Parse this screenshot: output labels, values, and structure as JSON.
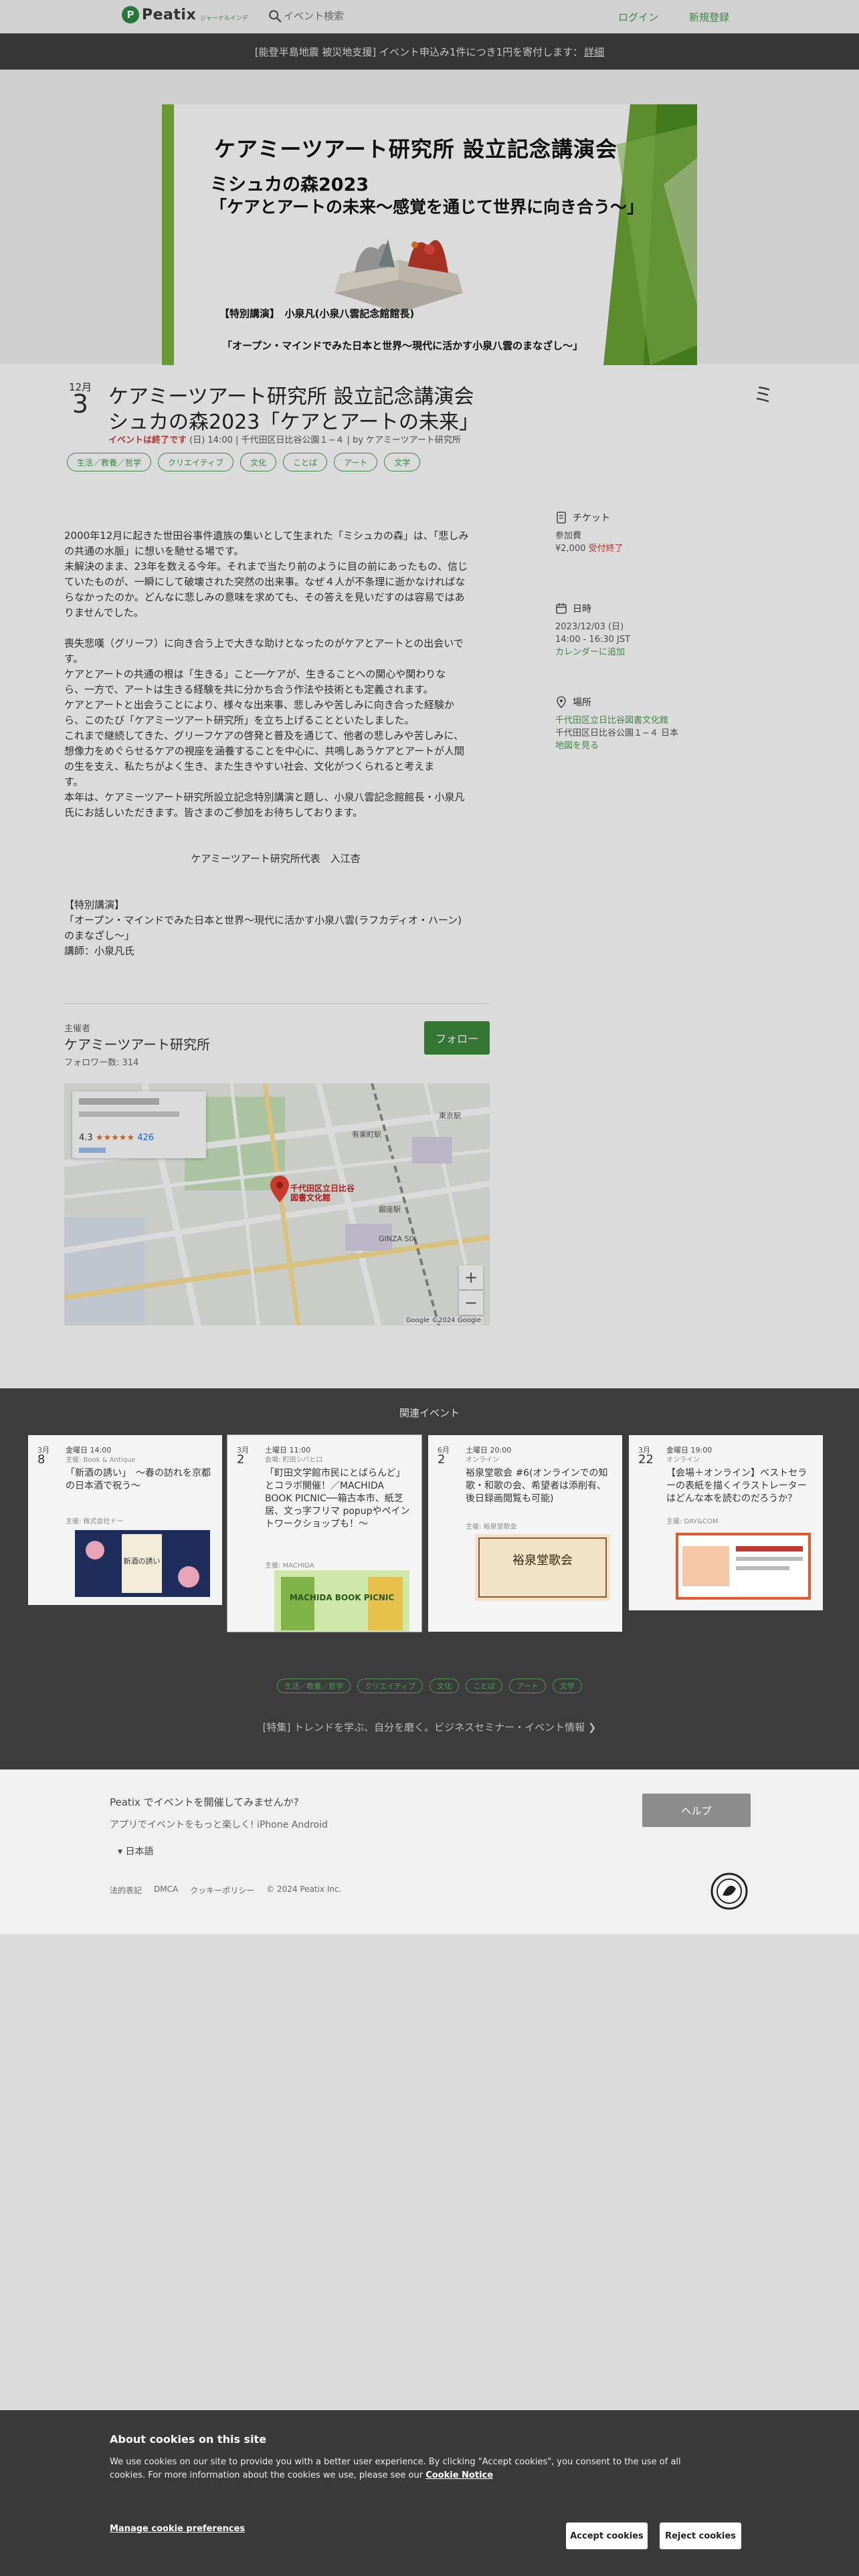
{
  "header": {
    "logo_mark": "P",
    "logo_text": "Peatix",
    "logo_sub": "ジャーナルインデ",
    "search_placeholder": "イベント検索",
    "login": "ログイン",
    "signup": "新規登録"
  },
  "notice": {
    "text": "[能登半島地震 被災地支援] イベント申込み1件につき1円を寄付します：",
    "link": "詳細"
  },
  "hero": {
    "title": "ケアミーツアート研究所 設立記念講演会",
    "sub1": "ミシュカの森2023",
    "sub2": "「ケアとアートの未来〜感覚を通じて世界に向き合う〜」",
    "lecture": "【特別講演】　小泉凡(小泉八雲記念館館長)",
    "lecture2": "「オープン・マインドでみた日本と世界〜現代に活かす小泉八雲のまなざし〜」"
  },
  "event": {
    "month": "12月",
    "day": "3",
    "title1": "ケアミーツアート研究所 設立記念講演会",
    "title2": "シュカの森2023「ケアとアートの未来」",
    "ended": "イベントは終了です",
    "meta": " (日) 14:00 | 千代田区日比谷公園１−４ | by ケアミーツアート研究所",
    "share": "ミ",
    "tags": [
      "生活／教養／哲学",
      "クリエイティブ",
      "文化",
      "ことば",
      "アート",
      "文学"
    ]
  },
  "description": {
    "para1": [
      "2000年12月に起きた世田谷事件遺族の集いとして生まれた「ミシュカの森」は、「悲しみ",
      "の共通の水脈」に想いを馳せる場です。",
      "未解決のまま、23年を数える今年。それまで当たり前のように目の前にあったもの、信じ",
      "ていたものが、一瞬にして破壊された突然の出来事。なぜ４人が不条理に逝かなければな",
      "らなかったのか。どんなに悲しみの意味を求めても、その答えを見いだすのは容易ではあ",
      "りませんでした。"
    ],
    "para2": [
      "喪失悲嘆（グリーフ）に向き合う上で大きな助けとなったのがケアとアートとの出会いで",
      "す。",
      "ケアとアートの共通の根は「生きる」こと──ケアが、生きることへの関心や関わりな",
      "ら、一方で、アートは生きる経験を共に分かち合う作法や技術とも定義されます。",
      "ケアとアートと出会うことにより、様々な出来事、悲しみや苦しみに向き合った経験か",
      "ら、このたび「ケアミーツアート研究所」を立ち上げることといたしました。",
      "これまで継続してきた、グリーフケアの啓発と普及を通じて、他者の悲しみや苦しみに、",
      "想像力をめぐらせるケアの視座を涵養することを中心に、共鳴しあうケアとアートが人間",
      "の生を支え、私たちがよく生き、また生きやすい社会、文化がつくられると考えま",
      "す。",
      "本年は、ケアミーツアート研究所設立記念特別講演と題し、小泉八雲記念館館長・小泉凡",
      "氏にお話しいただきます。皆さまのご参加をお待ちしております。"
    ],
    "signature": "ケアミーツアート研究所代表　入江杏",
    "para3": [
      "【特別講演】",
      "「オープン・マインドでみた日本と世界〜現代に活かす小泉八雲(ラフカディオ・ハーン)",
      "のまなざし〜」",
      "講師：小泉凡氏"
    ]
  },
  "sidebar": {
    "ticket_head": "チケット",
    "ticket_name": "参加費",
    "ticket_price": "¥2,000",
    "ticket_status": "受付終了",
    "date_head": "日時",
    "date_line1": "2023/12/03 (日)",
    "date_line2": "14:00 - 16:30 JST",
    "calendar": "カレンダーに追加",
    "place_head": "場所",
    "place_link": "千代田区立日比谷図書文化館",
    "place_addr": "千代田区日比谷公園１−４ 日本",
    "map_link": "地図を見る"
  },
  "organizer": {
    "label": "主催者",
    "name": "ケアミーツアート研究所",
    "followers": "フォロワー数: 314",
    "follow": "フォロー"
  },
  "map": {
    "rating": "4.3",
    "stars": "★★★★★",
    "count": "426",
    "pin_label1": "千代田区立日比谷",
    "pin_label2": "図書文化館",
    "label_a": "有楽町駅",
    "label_b": "銀座駅",
    "label_c": "GINZA SIX",
    "label_d": "東京駅",
    "zoom_in": "+",
    "zoom_out": "−",
    "copyright": "Google  ©2024 Google"
  },
  "related": {
    "title": "関連イベント",
    "cards": [
      {
        "month": "3月",
        "day": "8",
        "time": "金曜日 14:00",
        "place": "主催: Book & Antique",
        "title": "「新酒の誘い」　〜春の訪れを京都の日本酒で祝う〜",
        "org": "主催: 株式会社ドー",
        "img": "新酒の誘い"
      },
      {
        "month": "3月",
        "day": "2",
        "time": "土曜日 11:00",
        "place": "会場: 町田シバヒロ",
        "title": "「町田文学館市民にとばらんど」とコラボ開催！／MACHIDA BOOK PICNIC──箱古本市、紙芝居、文っ字フリマ popupやペイントワークショップも！〜",
        "org": "主催: MACHIDA",
        "img": "MACHIDA BOOK PICNIC"
      },
      {
        "month": "6月",
        "day": "2",
        "time": "土曜日 20:00",
        "place": "オンライン",
        "title": "裕泉堂歌会 #6(オンラインでの知歌・和歌の会、希望者は添削有、後日録画閲覧も可能)",
        "org": "主催: 裕泉堂歌会",
        "img": "裕泉堂歌会"
      },
      {
        "month": "3月",
        "day": "22",
        "time": "金曜日 19:00",
        "place": "オンライン",
        "title": "【会場＋オンライン】ベストセラーの表紙を描くイラストレーターはどんな本を読むのだろうか？",
        "org": "主催: DAY&COM",
        "img": ""
      }
    ],
    "tags": [
      "生活／教養／哲学",
      "クリエイティブ",
      "文化",
      "ことば",
      "アート",
      "文学"
    ],
    "link": "[特集] トレンドを学ぶ、自分を磨く。ビジネスセミナー・イベント情報 ❯"
  },
  "footer": {
    "question": "Peatix でイベントを開催してみませんか?",
    "app": "アプリでイベントをもっと楽しく! iPhone Android",
    "lang": "▾  日本語",
    "help": "ヘルプ",
    "links": [
      "法的表記",
      "DMCA",
      "クッキーポリシー",
      "© 2024 Peatix Inc."
    ]
  },
  "cookie": {
    "title": "About cookies on this site",
    "body": "We use cookies on our site to provide you with a better user experience. By clicking \"Accept cookies\", you consent to the use of all cookies. For more information about the cookies we use, please see our ",
    "notice": "Cookie Notice",
    "manage": "Manage cookie preferences",
    "accept": "Accept cookies",
    "reject": "Reject cookies"
  },
  "colors": {
    "brand_green": "#4a9a52",
    "follow_green": "#3d8b3d",
    "ended_red": "#d83a3a",
    "dark_band": "#3c3c3c"
  }
}
